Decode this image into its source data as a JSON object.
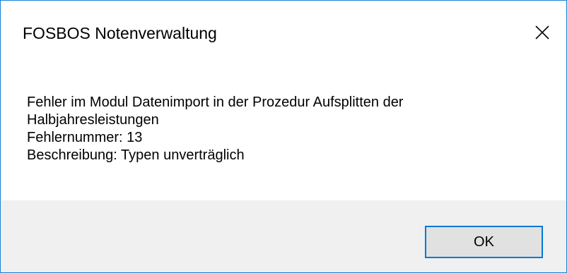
{
  "window": {
    "title": "FOSBOS Notenverwaltung"
  },
  "icons": {
    "close": "close-icon"
  },
  "message": {
    "lines": [
      "Fehler im Modul Datenimport in der Prozedur Aufsplitten der",
      "Halbjahresleistungen",
      "Fehlernummer: 13",
      "Beschreibung: Typen unverträglich"
    ]
  },
  "buttons": {
    "ok_label": "OK"
  },
  "colors": {
    "window_border": "#1883d7",
    "footer_background": "#f0f0f0",
    "button_focus_border": "#0078d7",
    "button_background": "#e1e1e1"
  }
}
